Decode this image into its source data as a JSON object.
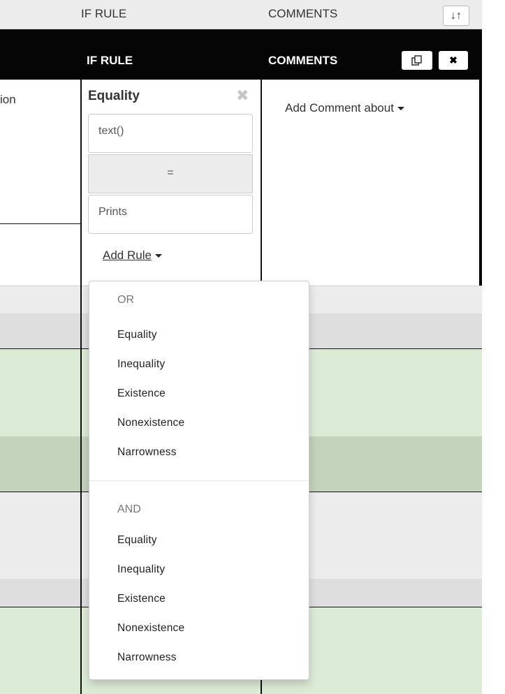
{
  "top_header": {
    "if_rule": "IF RULE",
    "comments": "COMMENTS",
    "sort_icon": "sort-toggle-icon"
  },
  "black_header": {
    "if_rule": "IF RULE",
    "comments": "COMMENTS",
    "copy_icon": "copy-icon",
    "close_icon": "close-icon"
  },
  "left_column": {
    "cut_text": "ion"
  },
  "rule": {
    "title": "Equality",
    "left_value": "text()",
    "operator": "=",
    "right_value": "Prints",
    "add_rule_label": "Add Rule"
  },
  "comments": {
    "add_comment_label": "Add Comment about"
  },
  "dropdown": {
    "or_header": "OR",
    "or_items": [
      "Equality",
      "Inequality",
      "Existence",
      "Nonexistence",
      "Narrowness"
    ],
    "and_header": "AND",
    "and_items": [
      "Equality",
      "Inequality",
      "Existence",
      "Nonexistence",
      "Narrowness"
    ]
  },
  "colors": {
    "header_grey": "#ececec",
    "header_black": "#050505",
    "row_green": "#dcebd6",
    "row_green_dark": "#c3d3bc",
    "row_grey": "#ececec",
    "row_grey_dark": "#dedede"
  }
}
